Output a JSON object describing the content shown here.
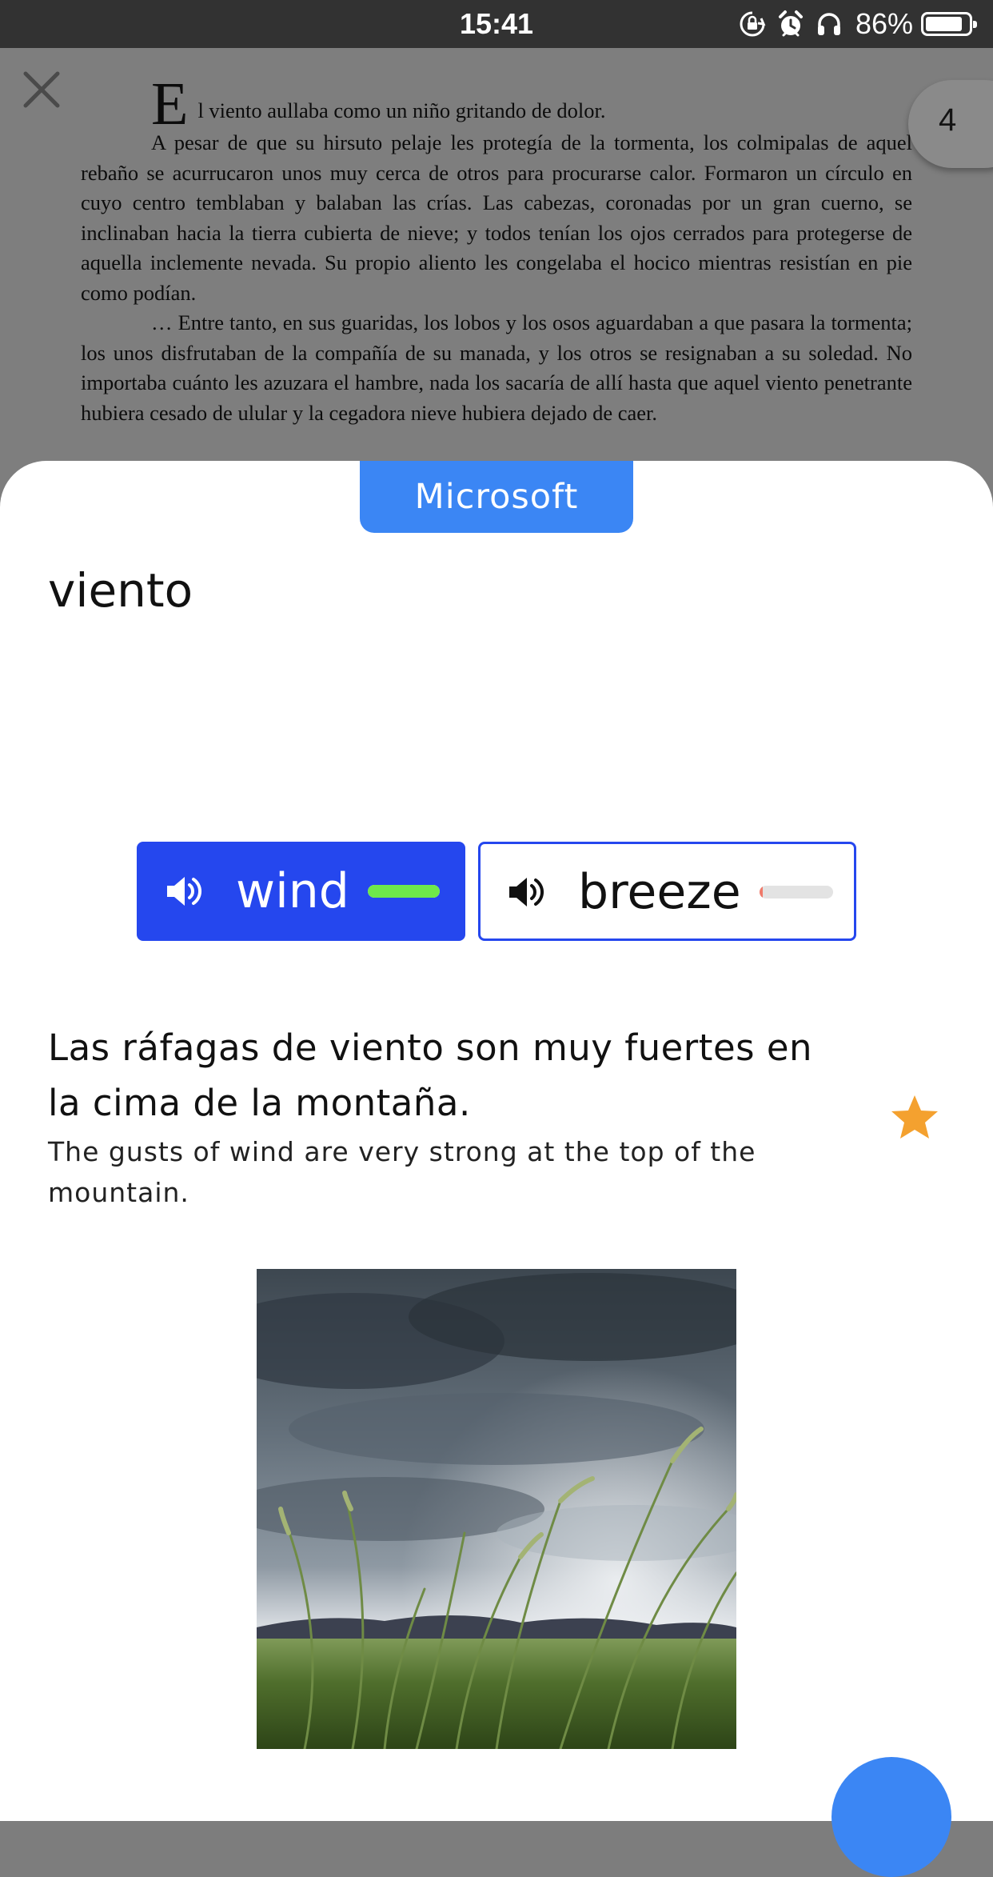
{
  "status_bar": {
    "time": "15:41",
    "battery_percent": "86%",
    "battery_level": 0.86,
    "icons": [
      "rotation-lock-icon",
      "alarm-icon",
      "headphones-icon",
      "battery-icon"
    ]
  },
  "reader": {
    "close_icon": "close-icon",
    "page_number": "4",
    "drop_cap": "E",
    "paragraph_1_rest": "l viento aullaba como un niño gritando de dolor.",
    "paragraph_2": "A pesar de que su hirsuto pelaje les protegía de la tormenta, los colmipalas de aquel rebaño se acurrucaron unos muy cerca de otros para procurarse calor. Formaron un círculo en cuyo centro temblaban y balaban las crías. Las cabezas, coronadas por un gran cuerno, se inclinaban hacia la tierra cubierta de nieve; y todos tenían los ojos cerrados para protegerse de aquella inclemente nevada. Su propio aliento les congelaba el hocico mientras resistían en pie como podían.",
    "paragraph_3": "… Entre tanto, en sus guaridas, los lobos y los osos aguardaban a que pasara la tormenta; los unos disfrutaban de la compañía de su manada, y los otros se resignaban a su soledad. No importaba cuánto les azuzara el hambre, nada los sacaría de allí hasta que aquel viento penetrante hubiera cesado de ulular y la cegadora nieve hubiera dejado de caer."
  },
  "dictionary": {
    "provider": "Microsoft",
    "headword": "viento",
    "translations": [
      {
        "label": "wind",
        "selected": true,
        "frequency": 1.0,
        "frequency_color": "#6ee84a"
      },
      {
        "label": "breeze",
        "selected": false,
        "frequency": 0.03,
        "frequency_color": "#f07a6a"
      }
    ],
    "example": {
      "spanish": "Las ráfagas de viento son muy fuertes en la cima de la montaña.",
      "english": "The gusts of wind are very strong at the top of the mountain.",
      "starred": true
    },
    "image_icon": "windy-grass-photo",
    "fab_icon": "action-button"
  },
  "colors": {
    "accent_blue": "#2547ee",
    "provider_blue": "#3b86f4",
    "star": "#f4a12f"
  }
}
